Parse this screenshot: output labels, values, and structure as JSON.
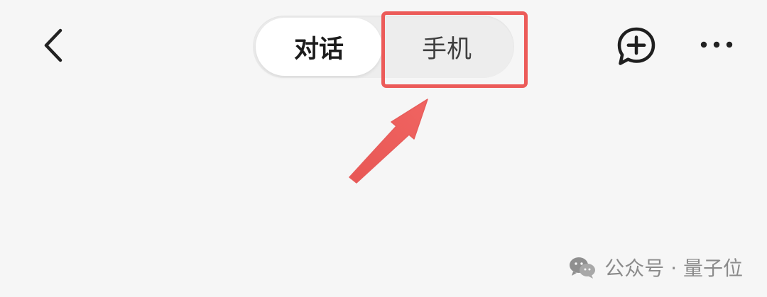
{
  "header": {
    "tabs": [
      {
        "label": "对话",
        "active": true
      },
      {
        "label": "手机",
        "active": false
      }
    ],
    "icons": {
      "back": "chevron-left-icon",
      "new_chat": "chat-plus-icon",
      "more": "more-dots-icon"
    }
  },
  "annotation": {
    "highlight_color": "#ec5b59",
    "arrow_color": "#ec5b59"
  },
  "watermark": {
    "text": "公众号 · 量子位",
    "icon": "wechat-icon"
  }
}
